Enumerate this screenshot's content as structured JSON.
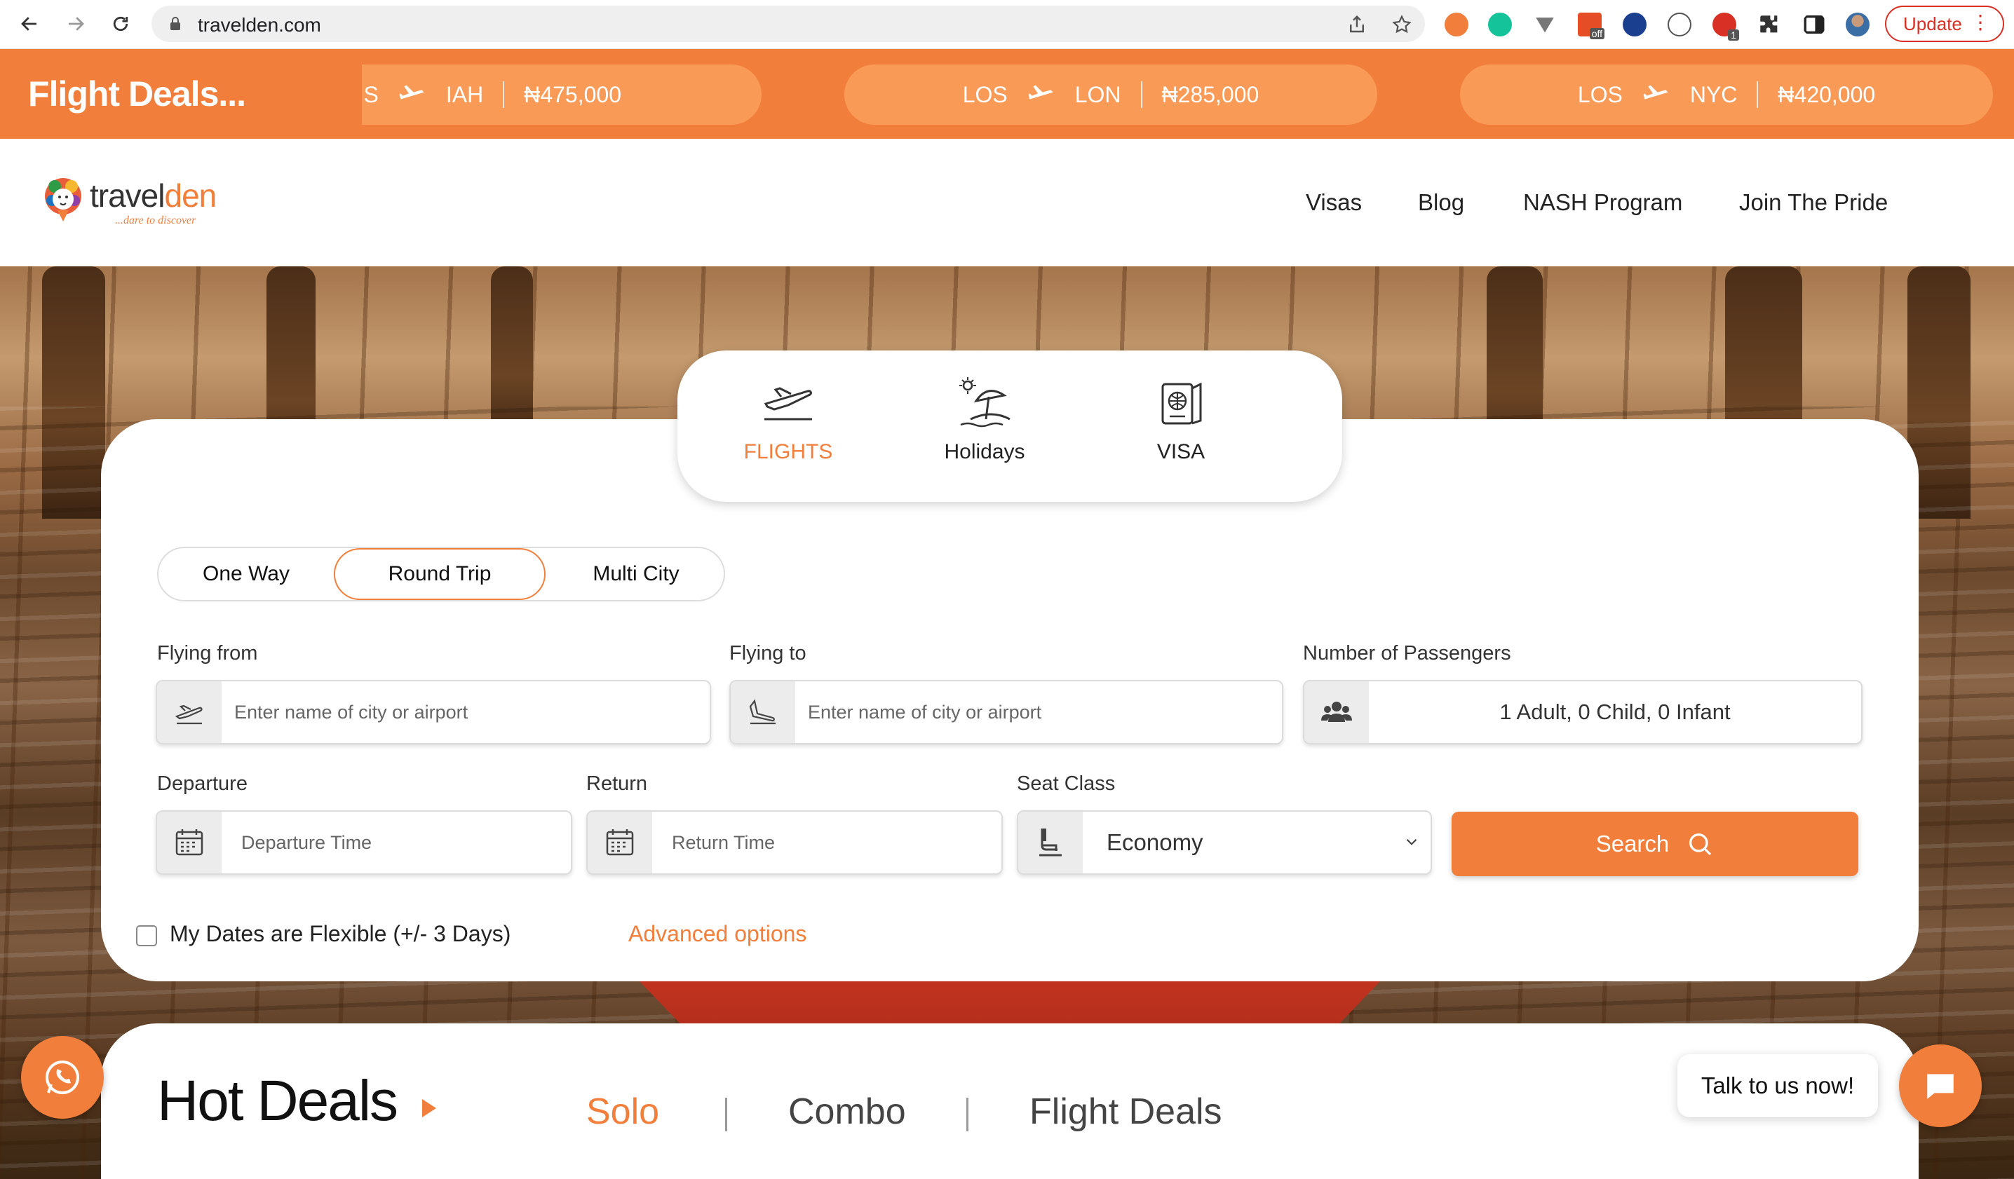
{
  "browser": {
    "url": "travelden.com",
    "update_label": "Update",
    "menu_glyph": "⋮",
    "ext_badge_off": "off",
    "ext_badge_count": "1"
  },
  "ticker": {
    "title": "Flight Deals...",
    "deals": [
      {
        "from": "S",
        "to": "IAH",
        "price": "₦475,000"
      },
      {
        "from": "LOS",
        "to": "LON",
        "price": "₦285,000"
      },
      {
        "from": "LOS",
        "to": "NYC",
        "price": "₦420,000"
      }
    ]
  },
  "brand": {
    "name_main": "travel",
    "name_accent": "den",
    "tagline": "...dare to discover",
    "accent_color": "#f27e3b"
  },
  "nav": {
    "items": [
      {
        "label": "Visas"
      },
      {
        "label": "Blog"
      },
      {
        "label": "NASH Program"
      },
      {
        "label": "Join The Pride"
      }
    ]
  },
  "services": {
    "tabs": [
      {
        "label": "FLIGHTS",
        "icon": "airplane-takeoff-icon",
        "active": true
      },
      {
        "label": "Holidays",
        "icon": "beach-umbrella-icon",
        "active": false
      },
      {
        "label": "VISA",
        "icon": "passport-icon",
        "active": false
      }
    ]
  },
  "trip_type": {
    "options": [
      {
        "label": "One Way",
        "active": false
      },
      {
        "label": "Round Trip",
        "active": true
      },
      {
        "label": "Multi City",
        "active": false
      }
    ]
  },
  "form": {
    "flying_from": {
      "label": "Flying from",
      "placeholder": "Enter name of city or airport",
      "value": ""
    },
    "flying_to": {
      "label": "Flying to",
      "placeholder": "Enter name of city or airport",
      "value": ""
    },
    "passengers": {
      "label": "Number of Passengers",
      "value": "1 Adult, 0 Child, 0 Infant"
    },
    "departure": {
      "label": "Departure",
      "placeholder": "Departure Time",
      "value": ""
    },
    "return": {
      "label": "Return",
      "placeholder": "Return Time",
      "value": ""
    },
    "seat_class": {
      "label": "Seat Class",
      "value": "Economy"
    },
    "search_label": "Search",
    "flexible_label": "My Dates are Flexible (+/- 3 Days)",
    "flexible_checked": false,
    "advanced_label": "Advanced options"
  },
  "hot_deals": {
    "title": "Hot Deals",
    "tabs": [
      {
        "label": "Solo",
        "active": true
      },
      {
        "label": "Combo",
        "active": false
      },
      {
        "label": "Flight Deals",
        "active": false
      }
    ],
    "separator": "|"
  },
  "widgets": {
    "talk_label": "Talk to us now!"
  }
}
